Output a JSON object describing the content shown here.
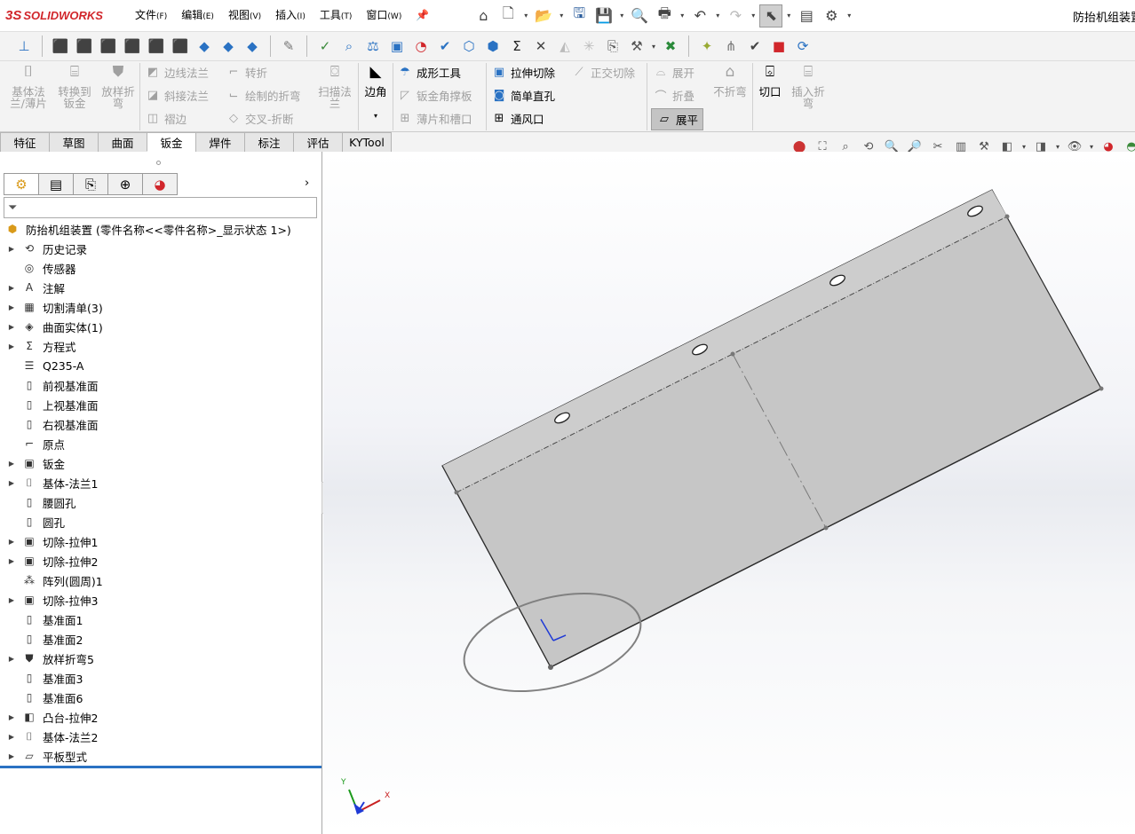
{
  "app": {
    "logo_text": "SOLIDWORKS",
    "logo_ds": "3S",
    "doc_title": "防抬机组装置"
  },
  "menu": [
    {
      "label": "文件",
      "key": "(F)"
    },
    {
      "label": "编辑",
      "key": "(E)"
    },
    {
      "label": "视图",
      "key": "(V)"
    },
    {
      "label": "插入",
      "key": "(I)"
    },
    {
      "label": "工具",
      "key": "(T)"
    },
    {
      "label": "窗口",
      "key": "(W)"
    }
  ],
  "ribbon": {
    "base_flange": "基体法兰/薄片",
    "base_flange_l1": "基体法",
    "base_flange_l2": "兰/薄片",
    "convert_l1": "转换到",
    "convert_l2": "钣金",
    "lofted_l1": "放样折",
    "lofted_l2": "弯",
    "edge_flange": "边线法兰",
    "miter_flange": "斜接法兰",
    "hem": "褶边",
    "jog": "转折",
    "sketched_bend": "绘制的折弯",
    "cross_break": "交叉-折断",
    "swept_l1": "扫描法",
    "swept_l2": "兰",
    "corners": "边角",
    "forming_tool": "成形工具",
    "gusset": "钣金角撑板",
    "tab_slot": "薄片和槽口",
    "extruded_cut": "拉伸切除",
    "simple_hole": "简单直孔",
    "vent": "通风口",
    "normal_cut": "正交切除",
    "unfold": "展开",
    "fold": "折叠",
    "flatten": "展平",
    "no_bends": "不折弯",
    "rip": "切口",
    "insert_bends_l1": "插入折",
    "insert_bends_l2": "弯"
  },
  "tabs": [
    "特征",
    "草图",
    "曲面",
    "钣金",
    "焊件",
    "标注",
    "评估",
    "KYTool"
  ],
  "active_tab": "钣金",
  "tree": {
    "root": "防抬机组装置 (零件名称<<零件名称>_显示状态 1>)",
    "items": [
      {
        "label": "历史记录",
        "icon": "history-icon",
        "expand": true
      },
      {
        "label": "传感器",
        "icon": "sensor-icon",
        "expand": false
      },
      {
        "label": "注解",
        "icon": "annotation-icon",
        "expand": true
      },
      {
        "label": "切割清单(3)",
        "icon": "cutlist-icon",
        "expand": true
      },
      {
        "label": "曲面实体(1)",
        "icon": "surface-body-icon",
        "expand": true
      },
      {
        "label": "方程式",
        "icon": "equation-icon",
        "expand": true
      },
      {
        "label": "Q235-A",
        "icon": "material-icon",
        "expand": false
      },
      {
        "label": "前视基准面",
        "icon": "plane-icon",
        "expand": false
      },
      {
        "label": "上视基准面",
        "icon": "plane-icon",
        "expand": false
      },
      {
        "label": "右视基准面",
        "icon": "plane-icon",
        "expand": false
      },
      {
        "label": "原点",
        "icon": "origin-icon",
        "expand": false
      },
      {
        "label": "钣金",
        "icon": "sheetmetal-icon",
        "expand": true
      },
      {
        "label": "基体-法兰1",
        "icon": "base-flange-icon",
        "expand": true
      },
      {
        "label": "腰圆孔",
        "icon": "plane-icon",
        "expand": false
      },
      {
        "label": "圆孔",
        "icon": "plane-icon",
        "expand": false
      },
      {
        "label": "切除-拉伸1",
        "icon": "cut-extrude-icon",
        "expand": true
      },
      {
        "label": "切除-拉伸2",
        "icon": "cut-extrude-icon",
        "expand": true
      },
      {
        "label": "阵列(圆周)1",
        "icon": "pattern-icon",
        "expand": false
      },
      {
        "label": "切除-拉伸3",
        "icon": "cut-extrude-icon",
        "expand": true
      },
      {
        "label": "基准面1",
        "icon": "plane-icon",
        "expand": false
      },
      {
        "label": "基准面2",
        "icon": "plane-icon",
        "expand": false
      },
      {
        "label": "放样折弯5",
        "icon": "lofted-bend-icon",
        "expand": true
      },
      {
        "label": "基准面3",
        "icon": "plane-icon",
        "expand": false
      },
      {
        "label": "基准面6",
        "icon": "plane-icon",
        "expand": false
      },
      {
        "label": "凸台-拉伸2",
        "icon": "boss-extrude-icon",
        "expand": true
      },
      {
        "label": "基体-法兰2",
        "icon": "base-flange-icon",
        "expand": true
      },
      {
        "label": "平板型式",
        "icon": "flat-pattern-icon",
        "expand": true
      }
    ]
  },
  "triad": {
    "x": "X",
    "y": "Y"
  },
  "colors": {
    "accent": "#2a72c3",
    "logo": "#d1262b",
    "part": "#c8c8c8"
  }
}
